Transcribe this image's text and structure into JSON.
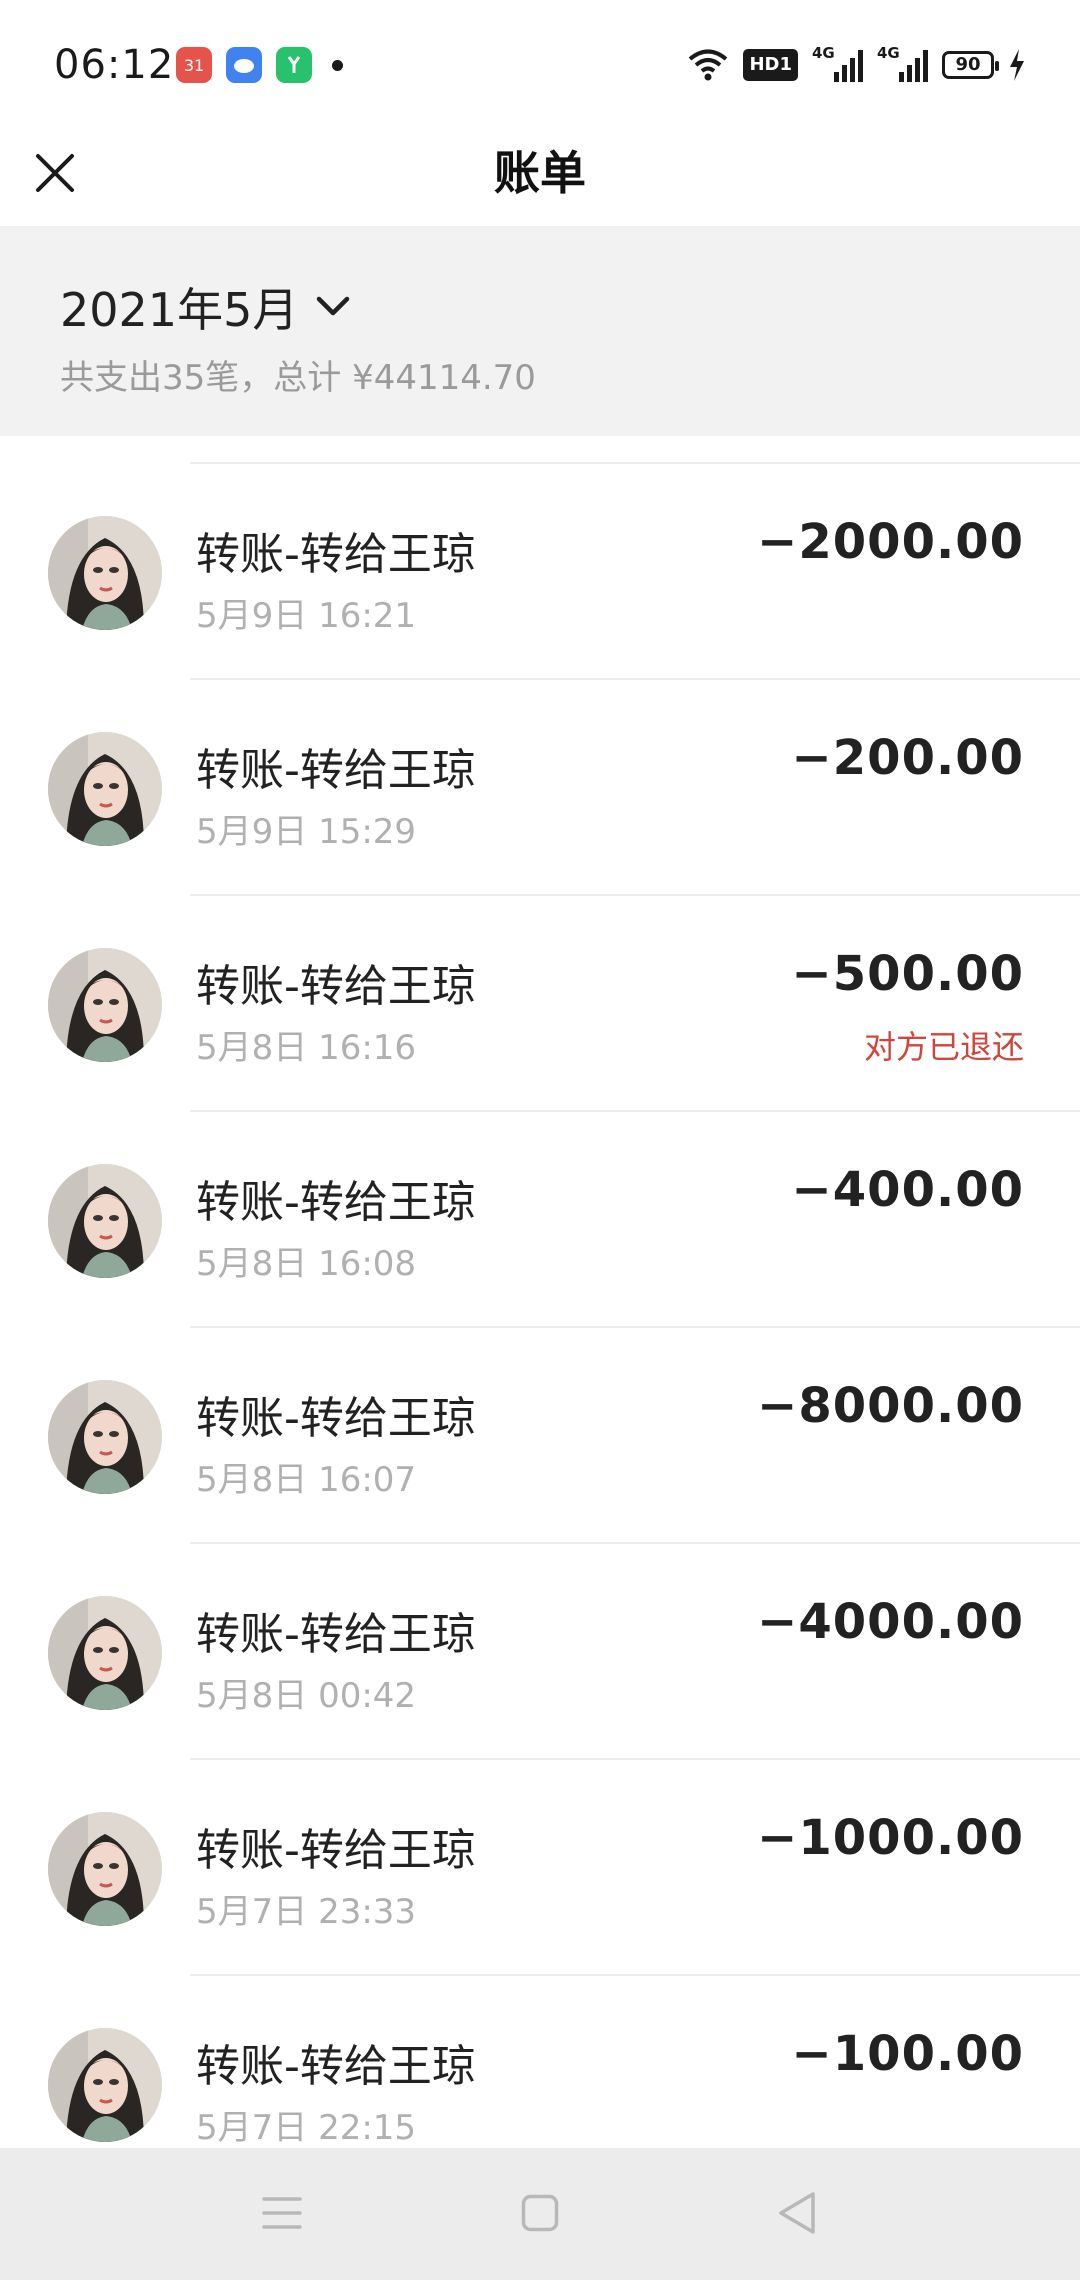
{
  "status_bar": {
    "time": "06:12",
    "apps": [
      {
        "name": "calendar-app-icon",
        "text": "31",
        "color": "#e5534b"
      },
      {
        "name": "cloud-app-icon",
        "text": "",
        "color": "#3f82f0"
      },
      {
        "name": "wechat-app-icon",
        "text": "",
        "color": "#27c26b"
      }
    ],
    "hd_label": "HD1",
    "signal_label_1": "4G",
    "signal_label_2": "4G",
    "battery": "90"
  },
  "header": {
    "title": "账单",
    "close_icon": "close-icon"
  },
  "summary": {
    "month": "2021年5月",
    "text": "共支出35笔，总计 ¥44114.70"
  },
  "transactions": [
    {
      "title": "转账-转给王琼",
      "time": "5月9日 16:21",
      "amount": "−2000.00",
      "status": ""
    },
    {
      "title": "转账-转给王琼",
      "time": "5月9日 15:29",
      "amount": "−200.00",
      "status": ""
    },
    {
      "title": "转账-转给王琼",
      "time": "5月8日 16:16",
      "amount": "−500.00",
      "status": "对方已退还"
    },
    {
      "title": "转账-转给王琼",
      "time": "5月8日 16:08",
      "amount": "−400.00",
      "status": ""
    },
    {
      "title": "转账-转给王琼",
      "time": "5月8日 16:07",
      "amount": "−8000.00",
      "status": ""
    },
    {
      "title": "转账-转给王琼",
      "time": "5月8日 00:42",
      "amount": "−4000.00",
      "status": ""
    },
    {
      "title": "转账-转给王琼",
      "time": "5月7日 23:33",
      "amount": "−1000.00",
      "status": ""
    },
    {
      "title": "转账-转给王琼",
      "time": "5月7日 22:15",
      "amount": "−100.00",
      "status": ""
    }
  ],
  "colors": {
    "refund_status": "#d0453a",
    "summary_bg": "#f2f2f2",
    "navbar_bg": "#ececec"
  }
}
